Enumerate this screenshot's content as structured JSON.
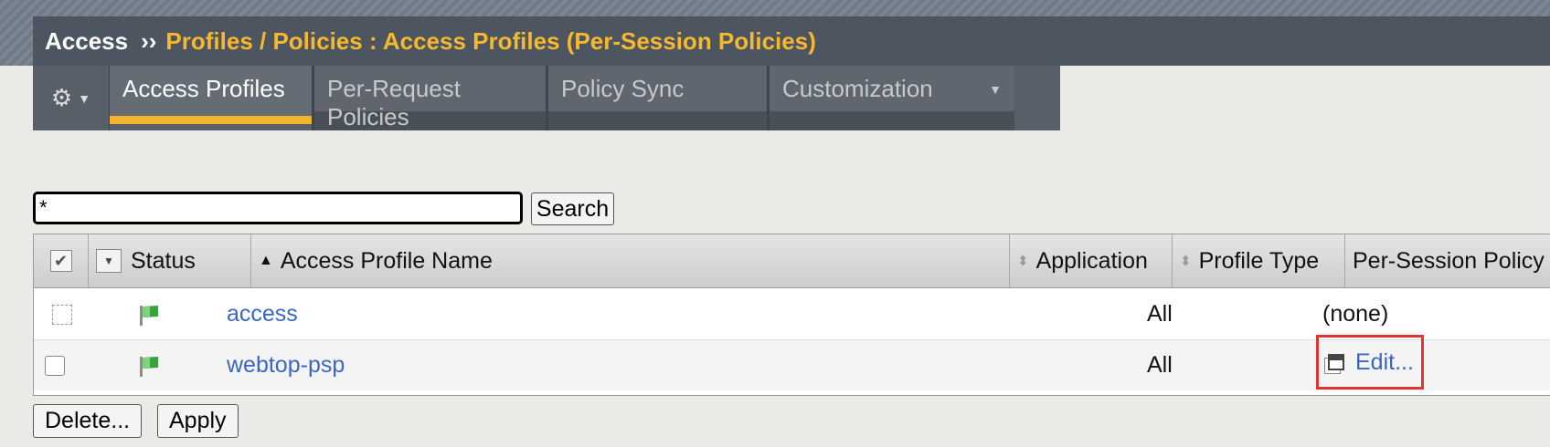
{
  "header": {
    "section": "Access",
    "separator": "››",
    "path": "Profiles / Policies : Access Profiles (Per-Session Policies)"
  },
  "tabs": {
    "gear_icon": "gear-icon",
    "items": [
      {
        "label": "Access Profiles",
        "active": true
      },
      {
        "label": "Per-Request Policies",
        "active": false
      },
      {
        "label": "Policy Sync",
        "active": false
      },
      {
        "label": "Customization",
        "active": false
      }
    ]
  },
  "search": {
    "value": "*",
    "button_label": "Search"
  },
  "table": {
    "columns": [
      "Status",
      "Access Profile Name",
      "Application",
      "Profile Type",
      "Per-Session Policy"
    ],
    "rows": [
      {
        "name": "access",
        "profile_type": "All",
        "policy": "(none)",
        "status": "green-flag"
      },
      {
        "name": "webtop-psp",
        "profile_type": "All",
        "policy": "Edit...",
        "status": "green-flag"
      }
    ]
  },
  "actions": {
    "delete_label": "Delete...",
    "apply_label": "Apply"
  },
  "colors": {
    "accent": "#f3b52c",
    "link": "#3a66c4",
    "highlight_box": "#e3342f"
  }
}
